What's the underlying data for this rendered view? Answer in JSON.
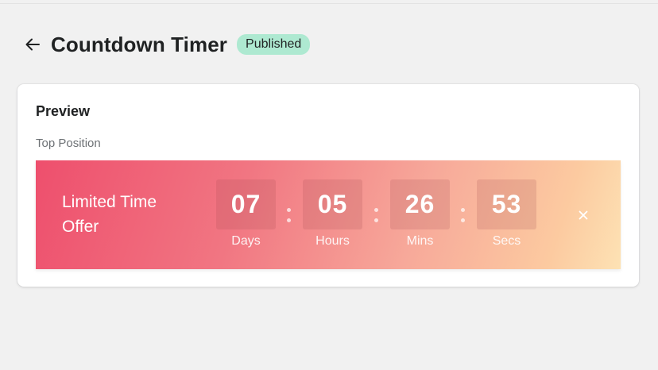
{
  "header": {
    "title": "Countdown Timer",
    "status_badge": "Published",
    "icons": {
      "back": "arrow-left-icon"
    }
  },
  "preview": {
    "title": "Preview",
    "position_label": "Top Position",
    "banner": {
      "offer_text": "Limited Time Offer",
      "units": [
        {
          "value": "07",
          "label": "Days"
        },
        {
          "value": "05",
          "label": "Hours"
        },
        {
          "value": "26",
          "label": "Mins"
        },
        {
          "value": "53",
          "label": "Secs"
        }
      ],
      "close_icon": "close-icon",
      "gradient_colors": [
        "#ee4f6d",
        "#f7a99a",
        "#fde2b4"
      ]
    }
  },
  "colors": {
    "background": "#f1f1f1",
    "badge_bg": "#aee9d1",
    "card_bg": "#ffffff"
  }
}
